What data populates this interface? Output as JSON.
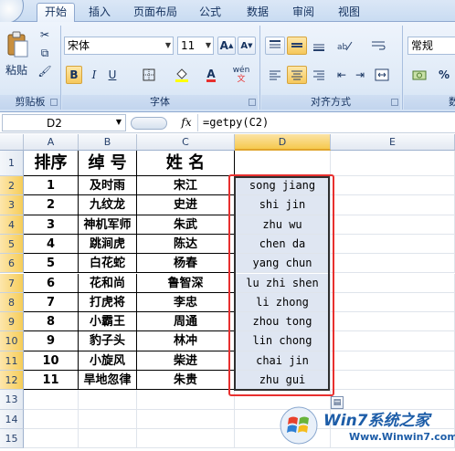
{
  "ribbon": {
    "tabs": [
      "开始",
      "插入",
      "页面布局",
      "公式",
      "数据",
      "审阅",
      "视图"
    ],
    "active_tab": "开始",
    "clipboard": {
      "paste_label": "粘贴",
      "group_label": "剪贴板"
    },
    "font": {
      "name": "宋体",
      "size": "11",
      "bold": "B",
      "italic": "I",
      "underline": "U",
      "phonetic": "wén",
      "group_label": "字体"
    },
    "alignment": {
      "group_label": "对齐方式"
    },
    "number": {
      "format": "常规",
      "group_label": "数"
    }
  },
  "formula_bar": {
    "name_box": "D2",
    "fx": "fx",
    "formula": "=getpy(C2)"
  },
  "sheet": {
    "columns": [
      "A",
      "B",
      "C",
      "D",
      "E"
    ],
    "selected_column": "D",
    "row_numbers": [
      "1",
      "2",
      "3",
      "4",
      "5",
      "6",
      "7",
      "8",
      "9",
      "10",
      "11",
      "12",
      "13",
      "14",
      "15"
    ],
    "headers": {
      "a": "排序",
      "b": "绰  号",
      "c": "姓  名"
    },
    "rows": [
      {
        "num": "1",
        "nick": "及时雨",
        "name": "宋江",
        "pinyin": "song jiang"
      },
      {
        "num": "2",
        "nick": "九纹龙",
        "name": "史进",
        "pinyin": "shi jin"
      },
      {
        "num": "3",
        "nick": "神机军师",
        "name": "朱武",
        "pinyin": "zhu wu"
      },
      {
        "num": "4",
        "nick": "跳涧虎",
        "name": "陈达",
        "pinyin": "chen da"
      },
      {
        "num": "5",
        "nick": "白花蛇",
        "name": "杨春",
        "pinyin": "yang chun"
      },
      {
        "num": "6",
        "nick": "花和尚",
        "name": "鲁智深",
        "pinyin": "lu zhi shen"
      },
      {
        "num": "7",
        "nick": "打虎将",
        "name": "李忠",
        "pinyin": "li zhong"
      },
      {
        "num": "8",
        "nick": "小霸王",
        "name": "周通",
        "pinyin": "zhou tong"
      },
      {
        "num": "9",
        "nick": "豹子头",
        "name": "林冲",
        "pinyin": "lin chong"
      },
      {
        "num": "10",
        "nick": "小旋风",
        "name": "柴进",
        "pinyin": "chai jin"
      },
      {
        "num": "11",
        "nick": "旱地忽律",
        "name": "朱贵",
        "pinyin": "zhu gui"
      }
    ]
  },
  "watermark": {
    "brand": "Win7系统之家",
    "url": "Www.Winwin7.com"
  },
  "colors": {
    "accent": "#e8302f",
    "selected_header": "#f6c94e",
    "pinyin_fill": "#dfe6f2"
  }
}
